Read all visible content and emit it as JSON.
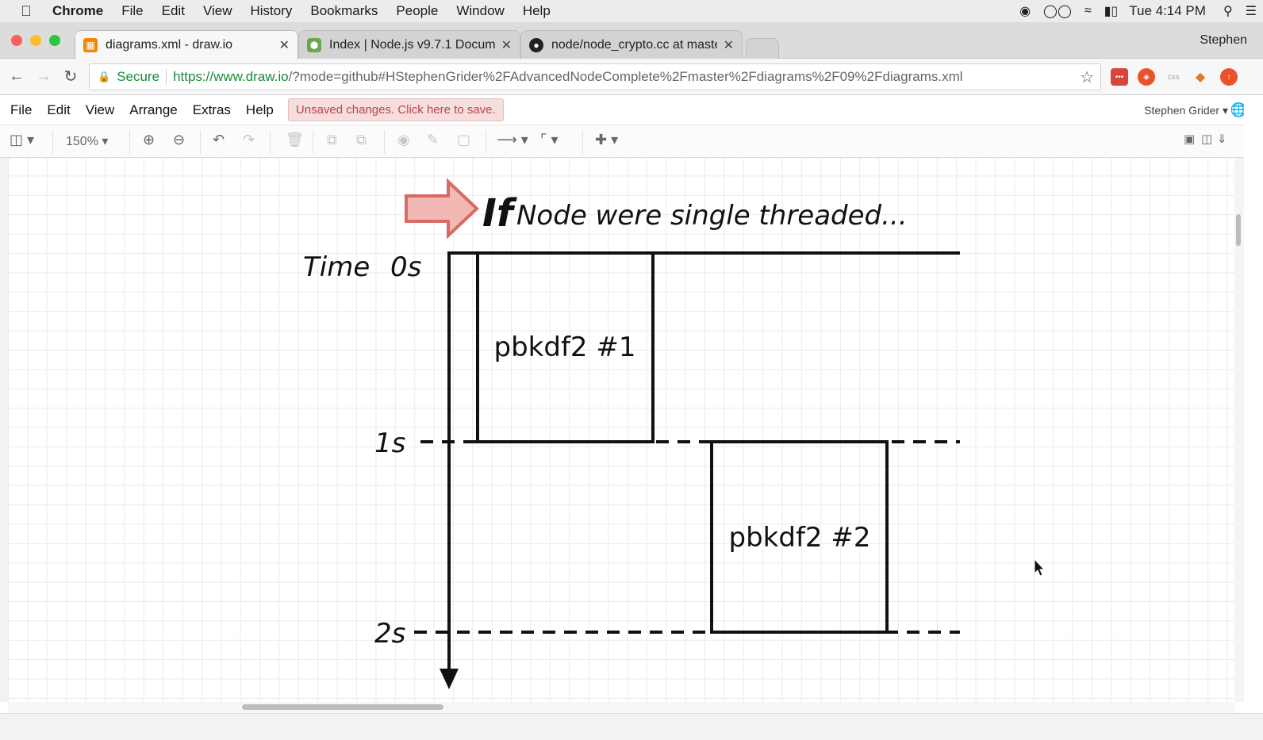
{
  "macos_menubar": {
    "app_name": "Chrome",
    "items": [
      "File",
      "Edit",
      "View",
      "History",
      "Bookmarks",
      "People",
      "Window",
      "Help"
    ],
    "clock": "Tue 4:14 PM"
  },
  "browser": {
    "tabs": [
      {
        "title": "diagrams.xml - draw.io",
        "active": true
      },
      {
        "title": "Index | Node.js v9.7.1 Documer",
        "active": false
      },
      {
        "title": "node/node_crypto.cc at maste",
        "active": false
      }
    ],
    "profile_name": "Stephen",
    "secure_label": "Secure",
    "url_host": "https://www.draw.io",
    "url_path": "/?mode=github#HStephenGrider%2FAdvancedNodeComplete%2Fmaster%2Fdiagrams%2F09%2Fdiagrams.xml"
  },
  "drawio": {
    "menu": [
      "File",
      "Edit",
      "View",
      "Arrange",
      "Extras",
      "Help"
    ],
    "unsaved_notice": "Unsaved changes. Click here to save.",
    "user_name": "Stephen Grider",
    "zoom_level": "150%"
  },
  "diagram": {
    "heading_if": "If",
    "heading_rest": "Node were single threaded...",
    "time_label": "Time",
    "ticks": [
      "0s",
      "1s",
      "2s"
    ],
    "boxes": [
      "pbkdf2 #1",
      "pbkdf2 #2"
    ]
  },
  "colors": {
    "arrow_fill": "#f2b8b4",
    "arrow_stroke": "#d86a66",
    "unsaved_bg": "#f6dede",
    "unsaved_text": "#b44444"
  }
}
